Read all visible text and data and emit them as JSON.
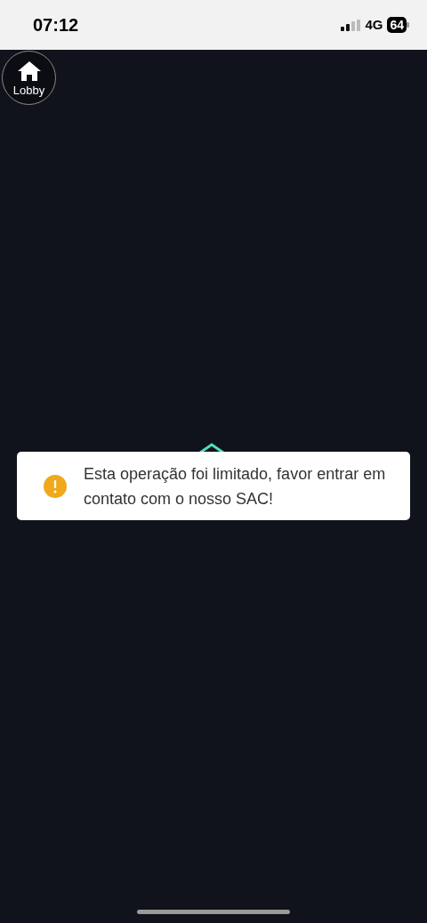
{
  "status_bar": {
    "time": "07:12",
    "network": "4G",
    "battery": "64"
  },
  "lobby_button": {
    "label": "Lobby"
  },
  "toast": {
    "kind": "warning",
    "message": "Esta operação foi limitado, favor entrar em contato com o nosso SAC!"
  }
}
